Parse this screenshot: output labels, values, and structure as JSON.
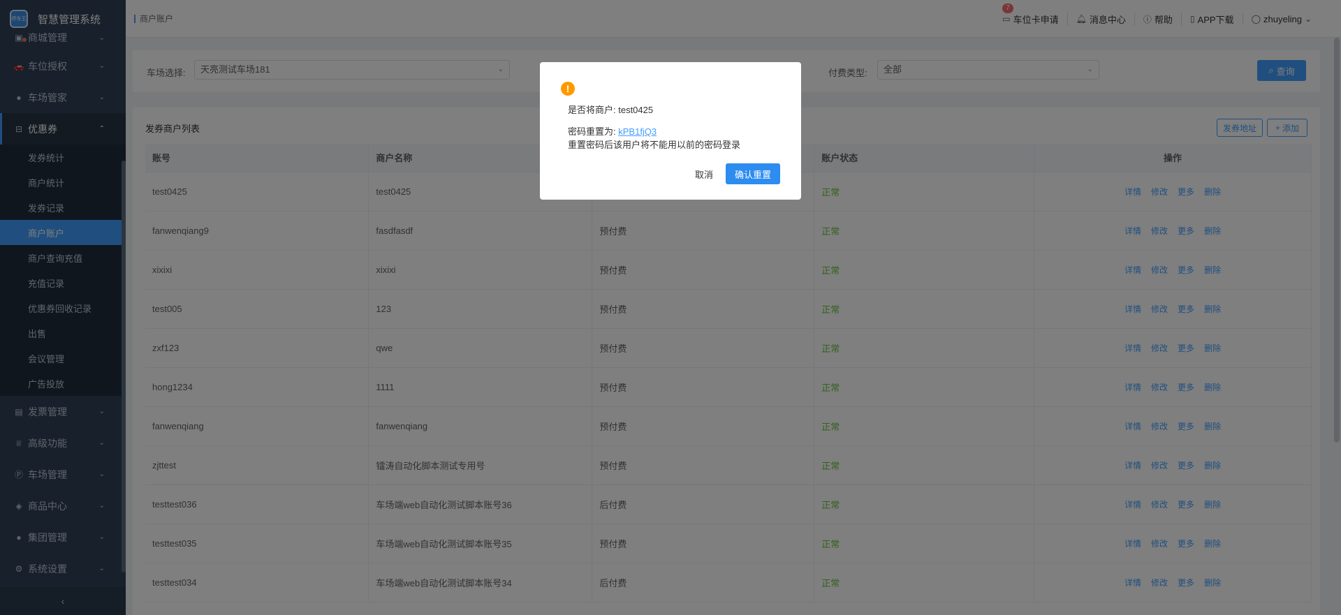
{
  "app": {
    "title": "智慧管理系统",
    "logo_text": "停车王"
  },
  "sidebar": {
    "items": [
      {
        "label": "商城管理",
        "icon": "shop-icon"
      },
      {
        "label": "车位授权",
        "icon": "car-icon"
      },
      {
        "label": "车场管家",
        "icon": "user-icon"
      },
      {
        "label": "优惠券",
        "icon": "coupon-icon"
      },
      {
        "label": "发票管理",
        "icon": "invoice-icon"
      },
      {
        "label": "高级功能",
        "icon": "crown-icon"
      },
      {
        "label": "车场管理",
        "icon": "parking-icon"
      },
      {
        "label": "商品中心",
        "icon": "layers-icon"
      },
      {
        "label": "集团管理",
        "icon": "group-icon"
      },
      {
        "label": "系统设置",
        "icon": "gear-icon"
      }
    ],
    "coupon_sub": [
      "发券统计",
      "商户统计",
      "发券记录",
      "商户账户",
      "商户查询充值",
      "充值记录",
      "优惠券回收记录",
      "出售",
      "会议管理",
      "广告投放"
    ],
    "collapse": "‹"
  },
  "header": {
    "breadcrumb": "商户账户",
    "badge_count": "7",
    "links": [
      "车位卡申请",
      "消息中心",
      "帮助",
      "APP下载",
      "zhuyeling"
    ]
  },
  "filter": {
    "park_label": "车场选择:",
    "park_value": "天亮测试车场181",
    "pay_label": "付费类型:",
    "pay_value": "全部",
    "query_button": "查询"
  },
  "panel": {
    "title": "发券商户列表",
    "addr_button": "发券地址",
    "add_button": "添加"
  },
  "table": {
    "headers": [
      "账号",
      "商户名称",
      "",
      "账户状态",
      "操作"
    ],
    "actions": [
      "详情",
      "修改",
      "更多",
      "删除"
    ],
    "rows": [
      [
        "test0425",
        "test0425",
        "",
        "正常"
      ],
      [
        "fanwenqiang9",
        "fasdfasdf",
        "预付费",
        "正常"
      ],
      [
        "xixixi",
        "xixixi",
        "预付费",
        "正常"
      ],
      [
        "test005",
        "123",
        "预付费",
        "正常"
      ],
      [
        "zxf123",
        "qwe",
        "预付费",
        "正常"
      ],
      [
        "hong1234",
        "1111",
        "预付费",
        "正常"
      ],
      [
        "fanwenqiang",
        "fanwenqiang",
        "预付费",
        "正常"
      ],
      [
        "zjttest",
        "镭涛自动化脚本测试专用号",
        "预付费",
        "正常"
      ],
      [
        "testtest036",
        "车场端web自动化测试脚本账号36",
        "后付费",
        "正常"
      ],
      [
        "testtest035",
        "车场端web自动化测试脚本账号35",
        "预付费",
        "正常"
      ],
      [
        "testtest034",
        "车场端web自动化测试脚本账号34",
        "后付费",
        "正常"
      ]
    ]
  },
  "dialog": {
    "line1": "是否将商户: test0425",
    "pwd_label": "密码重置为:",
    "pwd_value": "kPB1fjQ3",
    "line3": "重置密码后该用户将不能用以前的密码登录",
    "cancel": "取消",
    "confirm": "确认重置"
  },
  "colors": {
    "primary": "#409eff",
    "sidebar": "#304156",
    "success": "#67c23a",
    "warning": "#ff9900"
  }
}
